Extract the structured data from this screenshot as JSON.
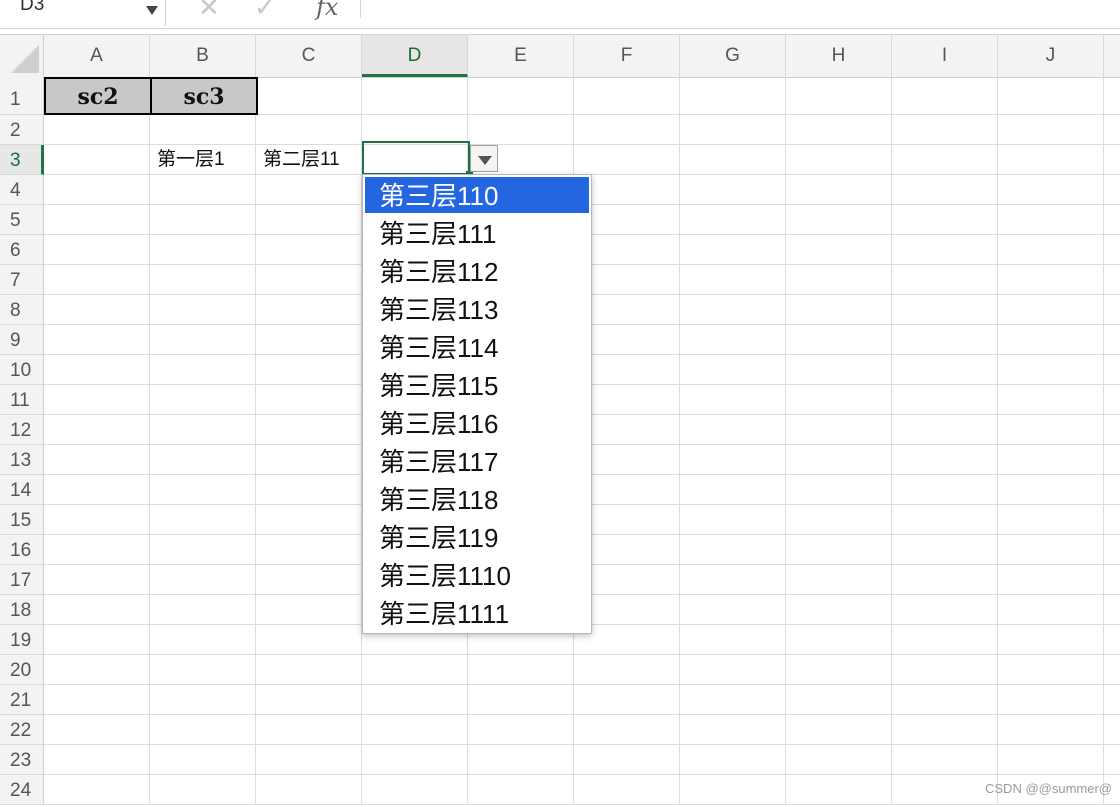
{
  "formula_bar": {
    "name_box": "D3",
    "cancel_glyph": "✕",
    "confirm_glyph": "✓",
    "fx_label": "fx"
  },
  "columns": [
    "A",
    "B",
    "C",
    "D",
    "E",
    "F",
    "G",
    "H",
    "I",
    "J"
  ],
  "active_column": "D",
  "rows": [
    "1",
    "2",
    "3",
    "4",
    "5",
    "6",
    "7",
    "8",
    "9",
    "10",
    "11",
    "12",
    "13",
    "14",
    "15",
    "16",
    "17",
    "18",
    "19",
    "20",
    "21",
    "22",
    "23",
    "24"
  ],
  "active_row": "3",
  "cells": {
    "A1": "sc2",
    "B1": "sc3",
    "B3": "第一层1",
    "C3": "第二层11",
    "D3": ""
  },
  "dropdown": {
    "selected_index": 0,
    "items": [
      "第三层110",
      "第三层111",
      "第三层112",
      "第三层113",
      "第三层114",
      "第三层115",
      "第三层116",
      "第三层117",
      "第三层118",
      "第三层119",
      "第三层1110",
      "第三层1111"
    ]
  },
  "colors": {
    "accent_green": "#217346",
    "selection_blue": "#2466e0",
    "header_fill": "#c8c8c8"
  },
  "watermark": "CSDN @@summer@"
}
